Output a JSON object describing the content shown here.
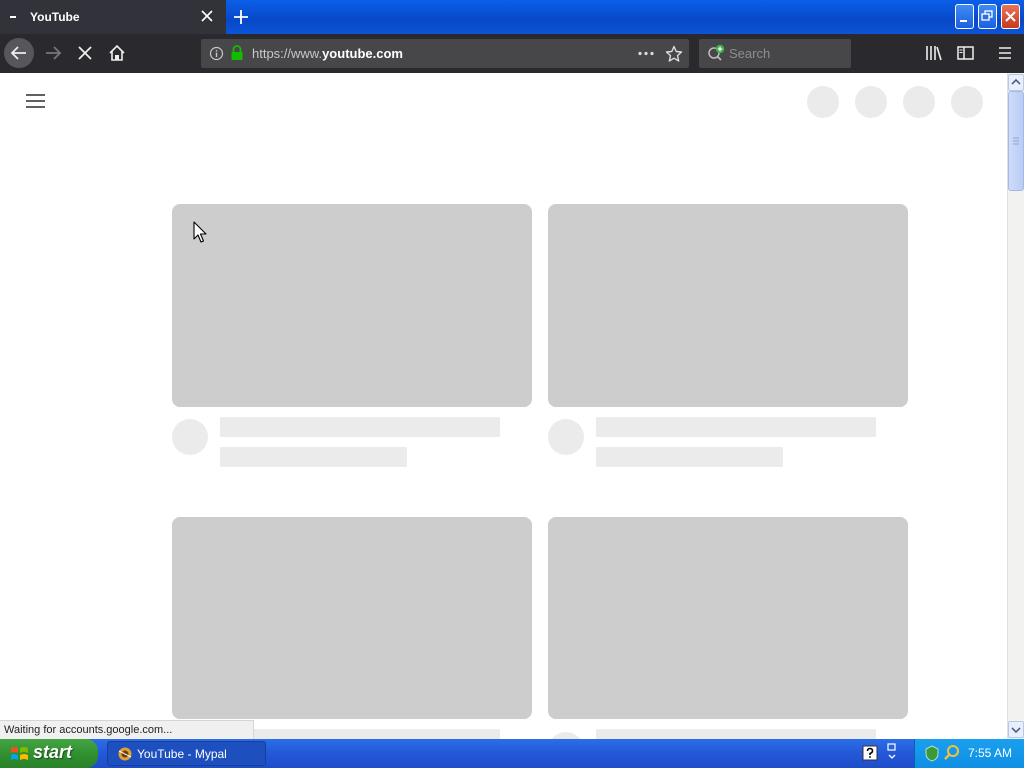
{
  "browser": {
    "tab": {
      "title": "YouTube"
    },
    "url": {
      "prefix": "https://www.",
      "domain": "youtube.com"
    },
    "search": {
      "placeholder": "Search"
    }
  },
  "status_text": "Waiting for accounts.google.com...",
  "taskbar": {
    "start_label": "start",
    "task_label": "YouTube - Mypal",
    "clock": "7:55 AM"
  },
  "colors": {
    "tab_bg": "#32323a",
    "toolbar_bg": "#2a2a2e",
    "urlbar_bg": "#474749",
    "lock_green": "#12bc00",
    "placeholder_thumb": "#cdcdcd",
    "placeholder_text": "#ebebeb",
    "xp_blue": "#2458d8",
    "xp_green": "#3a9a3a"
  },
  "icons": [
    "tab-favicon-icon",
    "tab-close-icon",
    "new-tab-icon",
    "back-arrow-icon",
    "forward-arrow-icon",
    "stop-icon",
    "home-icon",
    "info-icon",
    "lock-icon",
    "page-actions-icon",
    "bookmark-star-icon",
    "search-engine-icon",
    "library-icon",
    "sidebar-icon",
    "hamburger-menu-icon",
    "minimize-icon",
    "restore-icon",
    "close-window-icon",
    "windows-logo-icon",
    "mypal-icon",
    "help-icon",
    "network-icon",
    "tray-shield-icon",
    "tray-search-icon",
    "mouse-cursor-icon"
  ]
}
